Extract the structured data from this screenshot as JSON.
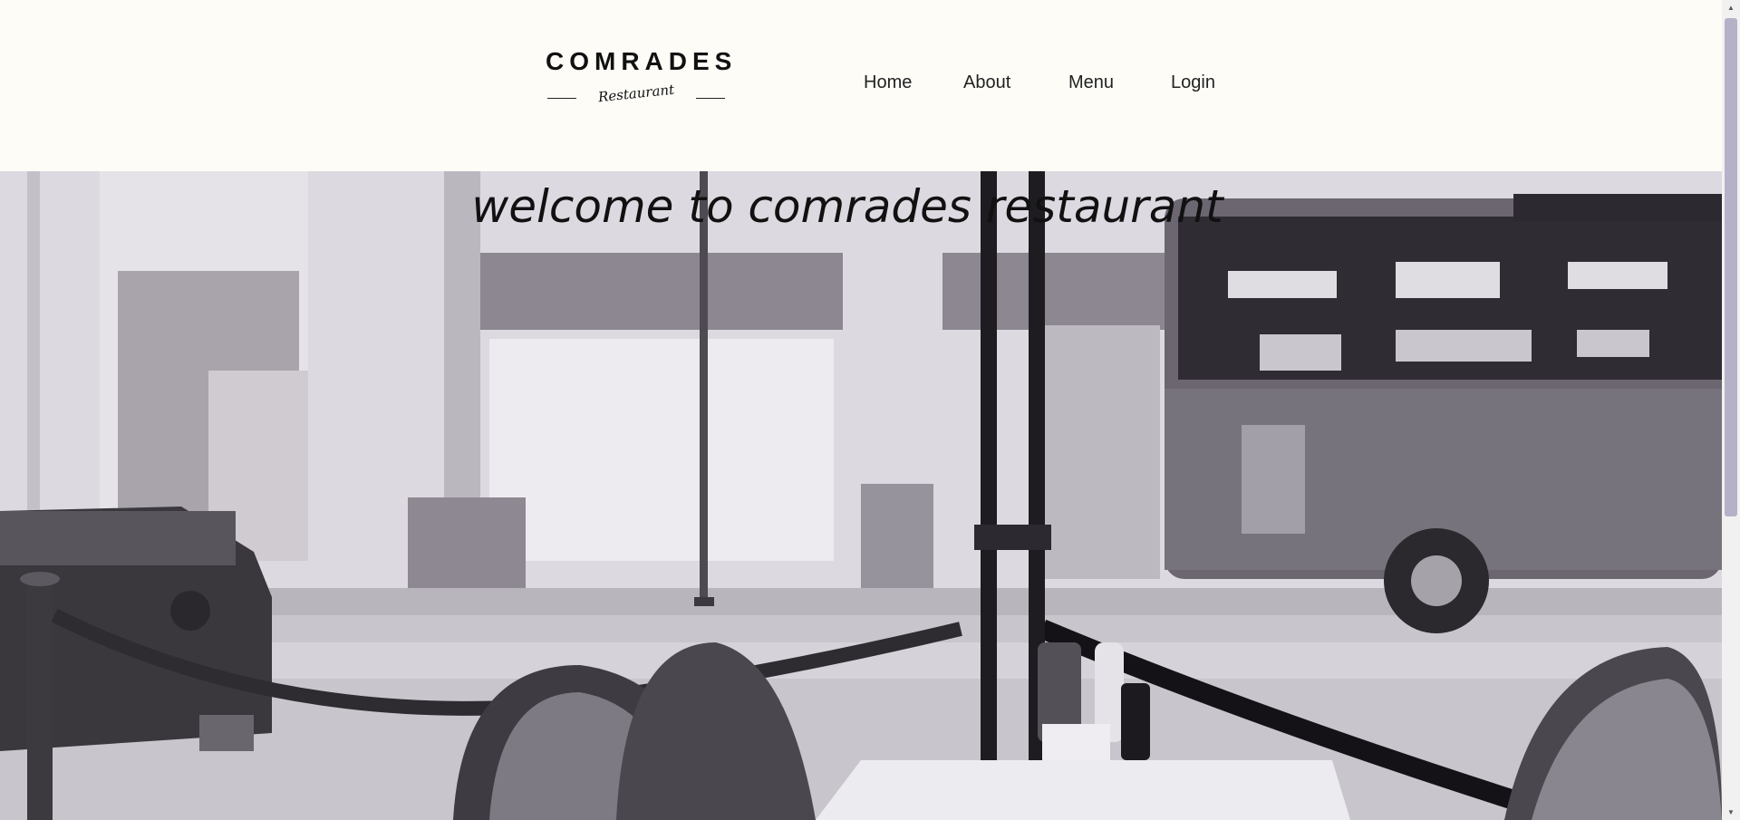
{
  "brand": {
    "name": "COMRADES",
    "tagline": "Restaurant"
  },
  "nav": {
    "items": [
      {
        "label": "Home"
      },
      {
        "label": "About"
      },
      {
        "label": "Menu"
      },
      {
        "label": "Login"
      }
    ]
  },
  "hero": {
    "title": "welcome to comrades restaurant"
  },
  "colors": {
    "header_bg": "#fdfcf7",
    "text": "#111111",
    "scroll_thumb": "#b4b1c8"
  },
  "icons": {
    "scroll_up": "triangle-up",
    "scroll_down": "triangle-down"
  }
}
